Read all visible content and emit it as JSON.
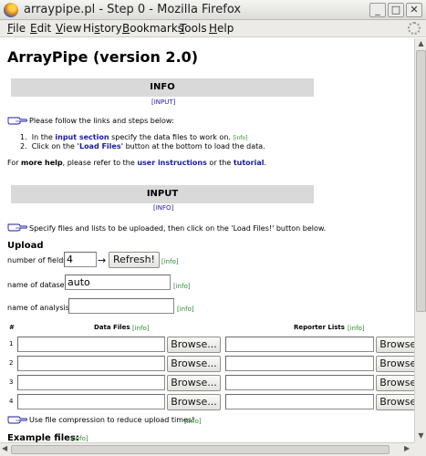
{
  "window": {
    "title": "arraypipe.pl - Step 0 - Mozilla Firefox",
    "buttons": {
      "minimize": "_",
      "maximize": "□",
      "close": "✕"
    }
  },
  "menu": [
    {
      "label_acc": "F",
      "label_rest": "ile"
    },
    {
      "label_acc": "E",
      "label_rest": "dit"
    },
    {
      "label_acc": "V",
      "label_rest": "iew"
    },
    {
      "label_acc": "",
      "label_pre": "Hi",
      "label_accmid": "s",
      "label_rest": "tory"
    },
    {
      "label_acc": "B",
      "label_rest": "ookmarks"
    },
    {
      "label_acc": "T",
      "label_rest": "ools"
    },
    {
      "label_acc": "H",
      "label_rest": "elp"
    }
  ],
  "page": {
    "title": "ArrayPipe (version 2.0)",
    "info_section": {
      "heading": "INFO",
      "anchor_link": "[INPUT]",
      "intro": "Please follow the links and steps below:",
      "step1_pre": "In the ",
      "step1_link": "input section",
      "step1_post": " specify the data files to work on.",
      "step1_info": "[info]",
      "step2_pre": "Click on the ",
      "step2_bold": "'Load Files'",
      "step2_post": " button at the bottom to load the data.",
      "help_pre": "For ",
      "help_bold": "more help",
      "help_mid": ", please refer to the ",
      "help_link1": "user instructions",
      "help_or": " or the ",
      "help_link2": "tutorial",
      "help_end": "."
    },
    "input_section": {
      "heading": "INPUT",
      "anchor_link": "[INFO]",
      "intro": "Specify files and lists to be uploaded, then click on the 'Load Files!' button below.",
      "upload_heading": "Upload",
      "fields_label": "number of fields",
      "fields_value": "4",
      "arrow": "→",
      "refresh_button": "Refresh!",
      "info": "[info]",
      "dataset_label": "name of dataset:",
      "dataset_value": "auto",
      "analysis_label": "name of analysis:",
      "analysis_value": "",
      "hash_col": "#",
      "data_files_col": "Data Files",
      "reporter_lists_col": "Reporter Lists",
      "rows": [
        "1",
        "2",
        "3",
        "4"
      ],
      "browse": "Browse...",
      "compression_note": "Use file compression to reduce upload times!",
      "example_heading": "Example files:"
    }
  },
  "colors": {
    "section_bar": "#d9d9d9",
    "link": "#1a1aa6",
    "info_link": "#2a8a2a"
  }
}
